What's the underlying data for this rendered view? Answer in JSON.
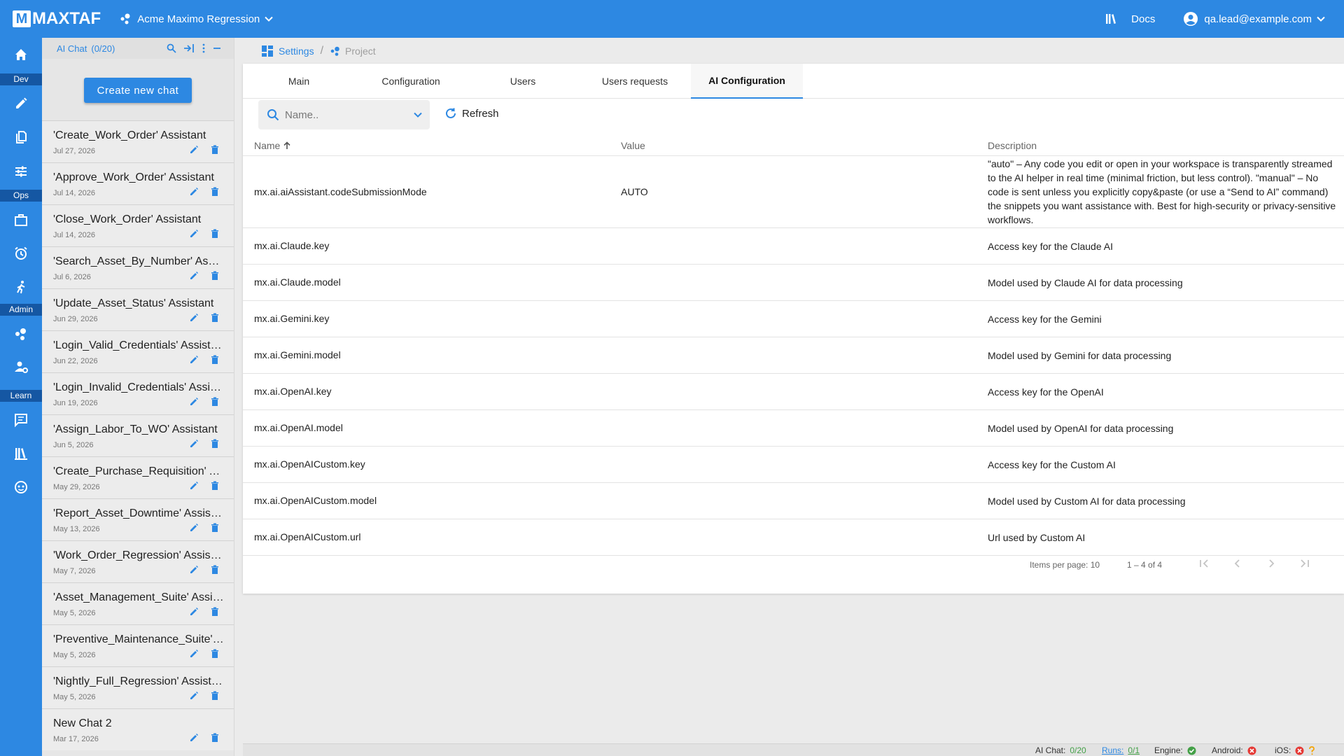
{
  "app": {
    "logo_letter": "M",
    "logo_text": "MAXTAF",
    "project_name": "Acme Maximo Regression",
    "docs_label": "Docs",
    "user_email": "qa.lead@example.com",
    "accent_color": "#2d88e2"
  },
  "rail": {
    "sections": {
      "dev": "Dev",
      "ops": "Ops",
      "admin": "Admin",
      "learn": "Learn"
    }
  },
  "chat_panel": {
    "title": "AI Chat",
    "count": "(0/20)",
    "create_label": "Create new chat",
    "chats": [
      {
        "title": "'Create_Work_Order' Assistant",
        "date": "Jul 27, 2026"
      },
      {
        "title": "'Approve_Work_Order' Assistant",
        "date": "Jul 14, 2026"
      },
      {
        "title": "'Close_Work_Order' Assistant",
        "date": "Jul 14, 2026"
      },
      {
        "title": "'Search_Asset_By_Number' Assistant",
        "date": "Jul 6, 2026"
      },
      {
        "title": "'Update_Asset_Status' Assistant",
        "date": "Jun 29, 2026"
      },
      {
        "title": "'Login_Valid_Credentials' Assistant",
        "date": "Jun 22, 2026"
      },
      {
        "title": "'Login_Invalid_Credentials' Assistant",
        "date": "Jun 19, 2026"
      },
      {
        "title": "'Assign_Labor_To_WO' Assistant",
        "date": "Jun 5, 2026"
      },
      {
        "title": "'Create_Purchase_Requisition' Assistant",
        "date": "May 29, 2026"
      },
      {
        "title": "'Report_Asset_Downtime' Assistant",
        "date": "May 13, 2026"
      },
      {
        "title": "'Work_Order_Regression' Assistant",
        "date": "May 7, 2026"
      },
      {
        "title": "'Asset_Management_Suite' Assistant",
        "date": "May 5, 2026"
      },
      {
        "title": "'Preventive_Maintenance_Suite' Assistant",
        "date": "May 5, 2026"
      },
      {
        "title": "'Nightly_Full_Regression' Assistant",
        "date": "May 5, 2026"
      },
      {
        "title": "New Chat 2",
        "date": "Mar 17, 2026"
      }
    ]
  },
  "breadcrumb": {
    "settings": "Settings",
    "sep": "/",
    "project": "Project"
  },
  "tabs": [
    {
      "label": "Main",
      "active": false
    },
    {
      "label": "Configuration",
      "active": false
    },
    {
      "label": "Users",
      "active": false
    },
    {
      "label": "Users requests",
      "active": false
    },
    {
      "label": "AI Configuration",
      "active": true
    }
  ],
  "toolbar": {
    "search_placeholder": "Name..",
    "refresh_label": "Refresh"
  },
  "table": {
    "columns": {
      "name": "Name",
      "value": "Value",
      "description": "Description"
    },
    "rows": [
      {
        "name": "mx.ai.aiAssistant.codeSubmissionMode",
        "value": "AUTO",
        "description": "\"auto\" – Any code you edit or open in your workspace is transparently streamed to the AI helper in real time (minimal friction, but less control). \"manual\" – No code is sent unless you explicitly copy&paste (or use a “Send to AI” command) the snippets you want assistance with. Best for high-security or privacy-sensitive workflows."
      },
      {
        "name": "mx.ai.Claude.key",
        "value": "",
        "description": "Access key for the Claude AI"
      },
      {
        "name": "mx.ai.Claude.model",
        "value": "",
        "description": "Model used by Claude AI for data processing"
      },
      {
        "name": "mx.ai.Gemini.key",
        "value": "",
        "description": "Access key for the Gemini"
      },
      {
        "name": "mx.ai.Gemini.model",
        "value": "",
        "description": "Model used by Gemini for data processing"
      },
      {
        "name": "mx.ai.OpenAI.key",
        "value": "",
        "description": "Access key for the OpenAI"
      },
      {
        "name": "mx.ai.OpenAI.model",
        "value": "",
        "description": "Model used by OpenAI for data processing"
      },
      {
        "name": "mx.ai.OpenAICustom.key",
        "value": "",
        "description": "Access key for the Custom AI"
      },
      {
        "name": "mx.ai.OpenAICustom.model",
        "value": "",
        "description": "Model used by Custom AI for data processing"
      },
      {
        "name": "mx.ai.OpenAICustom.url",
        "value": "",
        "description": "Url used by Custom AI"
      }
    ]
  },
  "pager": {
    "items_per_page_label": "Items per page:",
    "items_per_page": "10",
    "range": "1 – 4 of 4"
  },
  "status": {
    "ai_chat_label": "AI Chat:",
    "ai_chat_value": "0/20",
    "runs_label": "Runs:",
    "runs_value": "0/1",
    "engine_label": "Engine:",
    "android_label": "Android:",
    "ios_label": "iOS:"
  }
}
